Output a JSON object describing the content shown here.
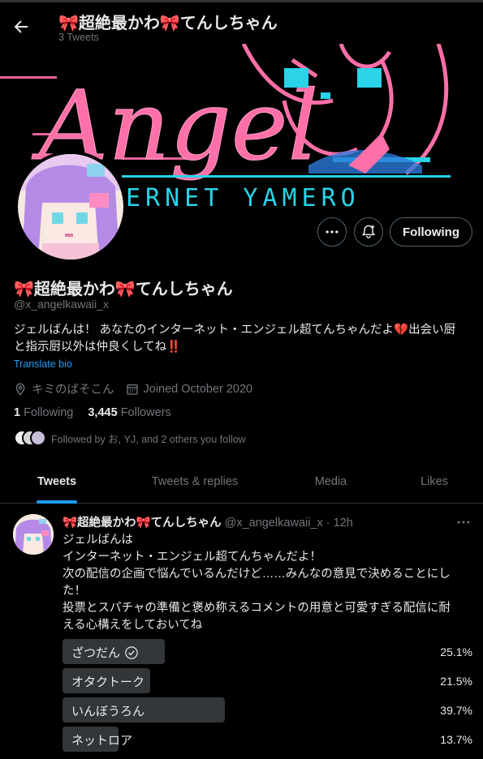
{
  "header": {
    "name": "🎀超絶最かわ🎀てんしちゃん",
    "tweet_count": "3 Tweets"
  },
  "banner": {
    "title_text": "Angel",
    "subtitle_text": "ERNET YAMERO",
    "colors": {
      "pink": "#ff6fa8",
      "cyan": "#2ad3e8",
      "blue": "#2b7bd8"
    }
  },
  "actions": {
    "more_icon": "more-icon",
    "notify_icon": "notification-bell-icon",
    "follow_label": "Following"
  },
  "profile": {
    "name": "🎀超絶最かわ🎀てんしちゃん",
    "handle": "@x_angelkawaii_x",
    "bio_line1": "ジェルばんは！ あなたのインターネット・エンジェル超てんちゃんだよ💔出会い厨",
    "bio_line2": "と指示厨以外は仲良くしてね‼️",
    "translate": "Translate bio",
    "location": "キミのばそこん",
    "joined": "Joined October 2020",
    "following_count": "1",
    "following_label": "Following",
    "followers_count": "3,445",
    "followers_label": "Followers",
    "followed_by": "Followed by お, YJ, and 2 others you follow"
  },
  "tabs": [
    {
      "label": "Tweets"
    },
    {
      "label": "Tweets & replies"
    },
    {
      "label": "Media"
    },
    {
      "label": "Likes"
    }
  ],
  "tweet": {
    "name": "🎀超絶最かわ🎀てんしちゃん",
    "meta": "@x_angelkawaii_x · 12h",
    "lines": [
      "ジェルばんは",
      "インターネット・エンジェル超てんちゃんだよ！",
      "次の配信の企画で悩んでいるんだけど……みんなの意見で決めることにし",
      "た！",
      "投票とスパチャの準備と褒め称えるコメントの用意と可愛すぎる配信に耐",
      "える心構えをしておいてね"
    ],
    "poll": [
      {
        "label": "ざつだん",
        "percent": "25.1%",
        "fraction": 0.251,
        "winner": true
      },
      {
        "label": "オタクトーク",
        "percent": "21.5%",
        "fraction": 0.215,
        "winner": false
      },
      {
        "label": "いんぼうろん",
        "percent": "39.7%",
        "fraction": 0.397,
        "winner": false
      },
      {
        "label": "ネットロア",
        "percent": "13.7%",
        "fraction": 0.137,
        "winner": false
      }
    ]
  },
  "colors": {
    "accent": "#1d9bf0",
    "text": "#e7e9ea",
    "muted": "#71767b",
    "poll_bar": "#333639"
  }
}
